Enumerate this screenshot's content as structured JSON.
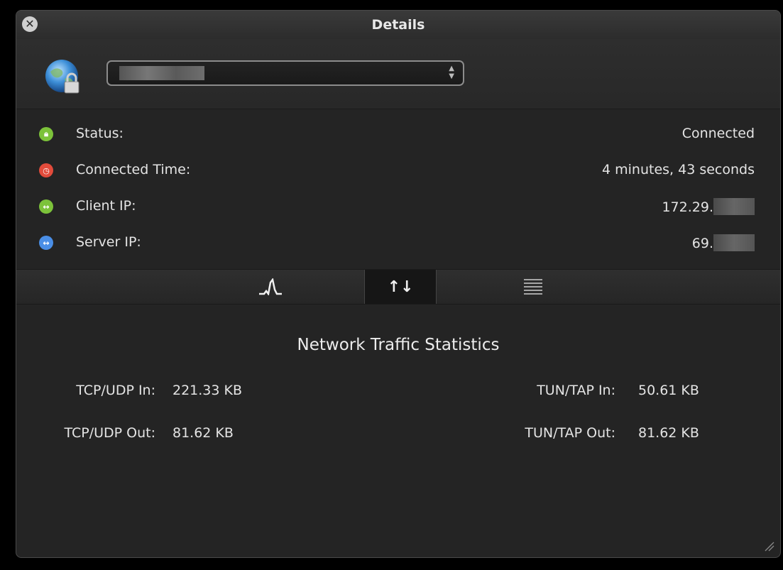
{
  "window": {
    "title": "Details",
    "close_icon": "close-x-icon"
  },
  "header": {
    "app_icon": "globe-lock-icon",
    "profile_select": {
      "value": "██████████",
      "arrows_icon": "updown-chevron-icon"
    }
  },
  "info_rows": [
    {
      "icon": "lock-icon",
      "icon_color": "#7cc23a",
      "label": "Status:",
      "value": "Connected"
    },
    {
      "icon": "clock-icon",
      "icon_color": "#e24b3b",
      "label": "Connected Time:",
      "value": "4 minutes, 43 seconds"
    },
    {
      "icon": "arrows-horizontal-icon",
      "icon_color": "#7cc23a",
      "label": "Client IP:",
      "value": "172.29."
    },
    {
      "icon": "arrows-horizontal-icon",
      "icon_color": "#4a8ee6",
      "label": "Server IP:",
      "value": "69."
    }
  ],
  "tabs": [
    {
      "name": "graph",
      "icon": "graph-peak-icon",
      "glyph": "ᴧᐱ"
    },
    {
      "name": "traffic",
      "icon": "updown-arrows-icon",
      "glyph": "↑↓",
      "active": true
    },
    {
      "name": "log",
      "icon": "log-lines-icon",
      "glyph": "≡"
    }
  ],
  "stats": {
    "title": "Network Traffic Statistics",
    "tcp_udp_in_label": "TCP/UDP In:",
    "tcp_udp_in_value": "221.33 KB",
    "tcp_udp_out_label": "TCP/UDP Out:",
    "tcp_udp_out_value": "81.62 KB",
    "tun_tap_in_label": "TUN/TAP In:",
    "tun_tap_in_value": "50.61 KB",
    "tun_tap_out_label": "TUN/TAP Out:",
    "tun_tap_out_value": "81.62 KB"
  }
}
